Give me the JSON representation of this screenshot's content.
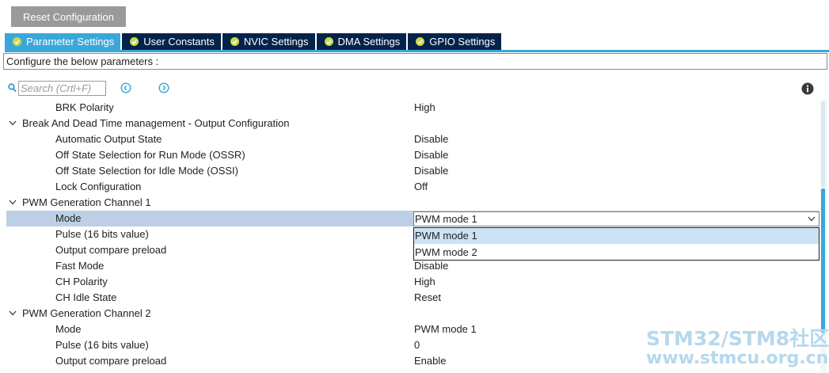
{
  "toolbar": {
    "reset_label": "Reset Configuration"
  },
  "tabs": [
    {
      "label": "Parameter Settings",
      "active": true
    },
    {
      "label": "User Constants",
      "active": false
    },
    {
      "label": "NVIC Settings",
      "active": false
    },
    {
      "label": "DMA Settings",
      "active": false
    },
    {
      "label": "GPIO Settings",
      "active": false
    }
  ],
  "config_label": "Configure the below parameters :",
  "search": {
    "placeholder": "Search (Crtl+F)"
  },
  "icons": [
    "search-icon",
    "chevron-left-icon",
    "chevron-right-icon",
    "info-icon",
    "check-icon",
    "chevron-down-icon"
  ],
  "params": [
    {
      "type": "item",
      "label": "BRK Polarity",
      "value": "High"
    },
    {
      "type": "group",
      "label": "Break And Dead Time management - Output Configuration"
    },
    {
      "type": "item",
      "label": "Automatic Output State",
      "value": "Disable"
    },
    {
      "type": "item",
      "label": "Off State Selection for Run Mode (OSSR)",
      "value": "Disable"
    },
    {
      "type": "item",
      "label": "Off State Selection for Idle Mode (OSSI)",
      "value": "Disable"
    },
    {
      "type": "item",
      "label": "Lock Configuration",
      "value": "Off"
    },
    {
      "type": "group",
      "label": "PWM Generation Channel 1"
    },
    {
      "type": "item",
      "label": "Mode",
      "value": "",
      "selected": true
    },
    {
      "type": "item",
      "label": "Pulse (16 bits value)",
      "value": ""
    },
    {
      "type": "item",
      "label": "Output compare preload",
      "value": ""
    },
    {
      "type": "item",
      "label": "Fast Mode",
      "value": "Disable"
    },
    {
      "type": "item",
      "label": "CH Polarity",
      "value": "High"
    },
    {
      "type": "item",
      "label": "CH Idle State",
      "value": "Reset"
    },
    {
      "type": "group",
      "label": "PWM Generation Channel 2"
    },
    {
      "type": "item",
      "label": "Mode",
      "value": "PWM mode 1"
    },
    {
      "type": "item",
      "label": "Pulse (16 bits value)",
      "value": "0"
    },
    {
      "type": "item",
      "label": "Output compare preload",
      "value": "Enable"
    }
  ],
  "mode_select": {
    "current": "PWM mode 1",
    "options": [
      {
        "label": "PWM mode 1",
        "highlighted": true
      },
      {
        "label": "PWM mode 2",
        "highlighted": false
      }
    ]
  },
  "watermark": {
    "line1": "STM32/STM8社区",
    "line2": "www.stmcu.org.cn"
  },
  "colors": {
    "tab_active": "#3aa7d9",
    "tab_inactive": "#03234b",
    "check": "#c8d94a",
    "selected_row": "#bccfe4"
  }
}
